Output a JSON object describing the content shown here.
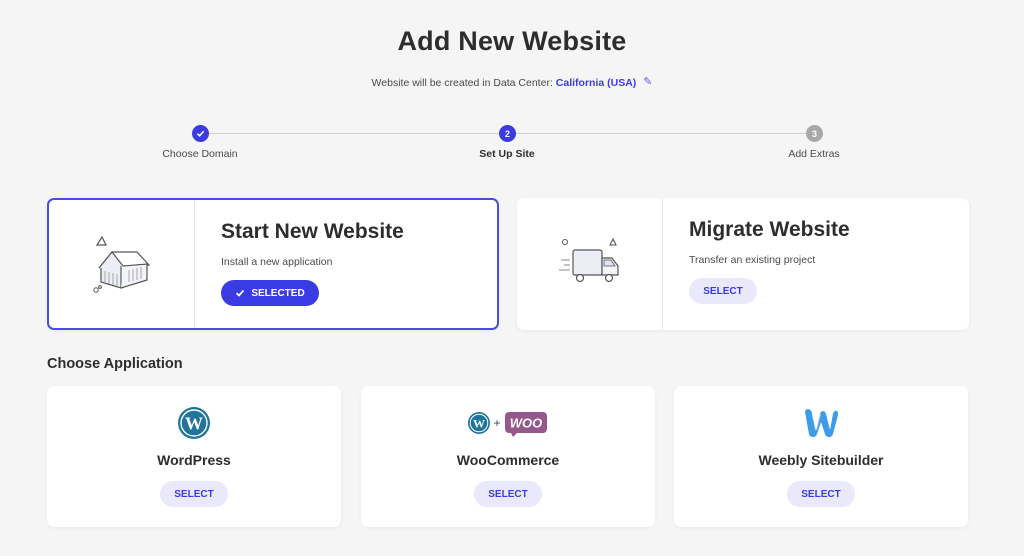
{
  "header": {
    "title": "Add New Website",
    "dc_prefix": "Website will be created in Data Center:",
    "dc_name": "California (USA)",
    "edit_icon": "pencil-icon"
  },
  "stepper": {
    "steps": [
      {
        "label": "Choose Domain",
        "number": "1",
        "state": "done"
      },
      {
        "label": "Set Up Site",
        "number": "2",
        "state": "active"
      },
      {
        "label": "Add Extras",
        "number": "3",
        "state": "todo"
      }
    ]
  },
  "options": [
    {
      "title": "Start New Website",
      "description": "Install a new application",
      "button": "SELECTED",
      "selected": true,
      "icon": "house-icon"
    },
    {
      "title": "Migrate Website",
      "description": "Transfer an existing project",
      "button": "SELECT",
      "selected": false,
      "icon": "truck-icon"
    }
  ],
  "apps_section": {
    "title": "Choose Application",
    "apps": [
      {
        "name": "WordPress",
        "button": "SELECT",
        "icon": "wordpress-icon"
      },
      {
        "name": "WooCommerce",
        "button": "SELECT",
        "icon": "woocommerce-icon",
        "logo_text": "WOO",
        "plus": "+"
      },
      {
        "name": "Weebly Sitebuilder",
        "button": "SELECT",
        "icon": "weebly-icon"
      }
    ]
  },
  "colors": {
    "accent": "#3b3be3",
    "accent_light": "#e9e9fb",
    "woo": "#96588a",
    "weebly": "#3e9be8",
    "wordpress": "#21759b"
  }
}
